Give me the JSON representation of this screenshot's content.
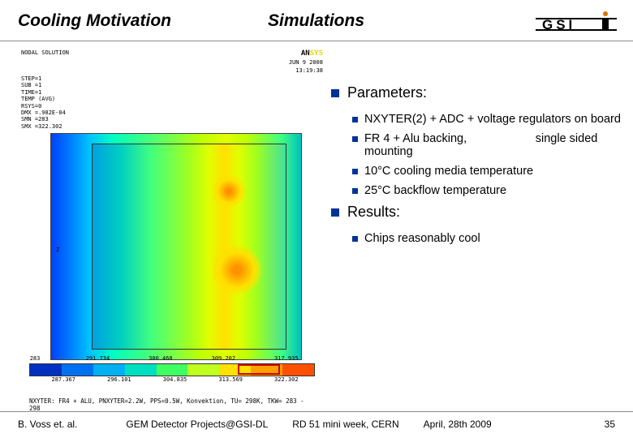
{
  "header": {
    "title_left": "Cooling Motivation",
    "title_center": "Simulations"
  },
  "logo": {
    "text": "GSI"
  },
  "simulation": {
    "software_label": "ANSYS",
    "nodal": "NODAL SOLUTION",
    "date": "JUN  9 2008",
    "time": "13:19:38",
    "meta_lines": [
      "STEP=1",
      "SUB =1",
      "TIME=1",
      "TEMP    (AVG)",
      "RSYS=0",
      "DMX =.982E-04",
      "SMN =283",
      "SMX =322.302"
    ],
    "z_label": "Z",
    "colorbar": {
      "colors": [
        "#0030c0",
        "#0070f0",
        "#00b0f0",
        "#00e0c0",
        "#40ff60",
        "#c0ff20",
        "#ffe000",
        "#ffa000",
        "#ff5000"
      ],
      "top_labels": [
        "283",
        "291.734",
        "300.468",
        "309.202",
        "317.935"
      ],
      "bot_labels": [
        "287.367",
        "296.101",
        "304.835",
        "313.569",
        "322.302"
      ]
    },
    "caption": "NXYTER: FR4 + ALU, PNXYTER=2.2W, PPS=0.5W, Konvektion, TU= 298K, TKW= 283 - 298"
  },
  "content": {
    "parameters_label": "Parameters:",
    "parameters": [
      "NXYTER(2) + ADC + voltage regulators on board",
      "FR 4 + Alu backing,                     single sided mounting",
      "10°C cooling media temperature",
      "25°C backflow temperature"
    ],
    "results_label": "Results:",
    "results": [
      "Chips reasonably cool"
    ]
  },
  "footer": {
    "author": "B. Voss et. al.",
    "project": "GEM Detector Projects@GSI-DL",
    "conference": "RD 51 mini week, CERN",
    "date": "April, 28th 2009",
    "page": "35"
  }
}
